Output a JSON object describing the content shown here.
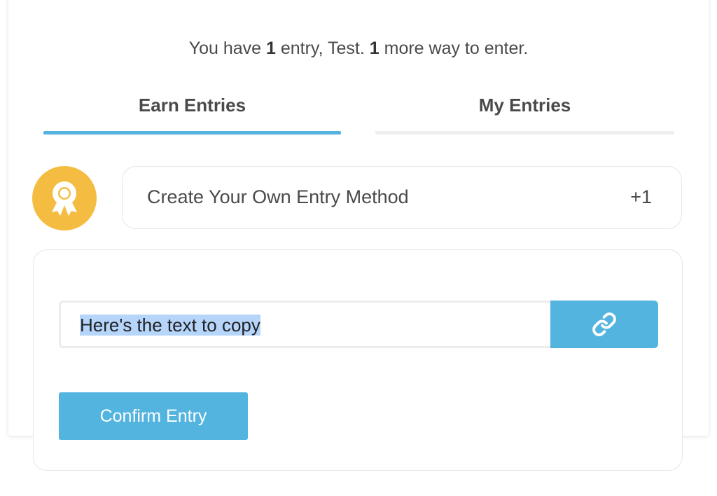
{
  "summary": {
    "prefix": "You have ",
    "entry_count": "1",
    "middle": " entry, Test.  ",
    "ways_count": "1",
    "suffix": " more way to enter."
  },
  "tabs": [
    {
      "label": "Earn Entries",
      "active": true
    },
    {
      "label": "My Entries",
      "active": false
    }
  ],
  "entry_method": {
    "icon": "award-ribbon-icon",
    "title": "Create Your Own Entry Method",
    "points": "+1"
  },
  "copy_field": {
    "value": "Here's the text to copy",
    "button_icon": "link-icon"
  },
  "confirm_button": {
    "label": "Confirm Entry"
  },
  "colors": {
    "accent": "#53b4df",
    "badge": "#f4bd42",
    "selection": "#b5d5fb"
  }
}
